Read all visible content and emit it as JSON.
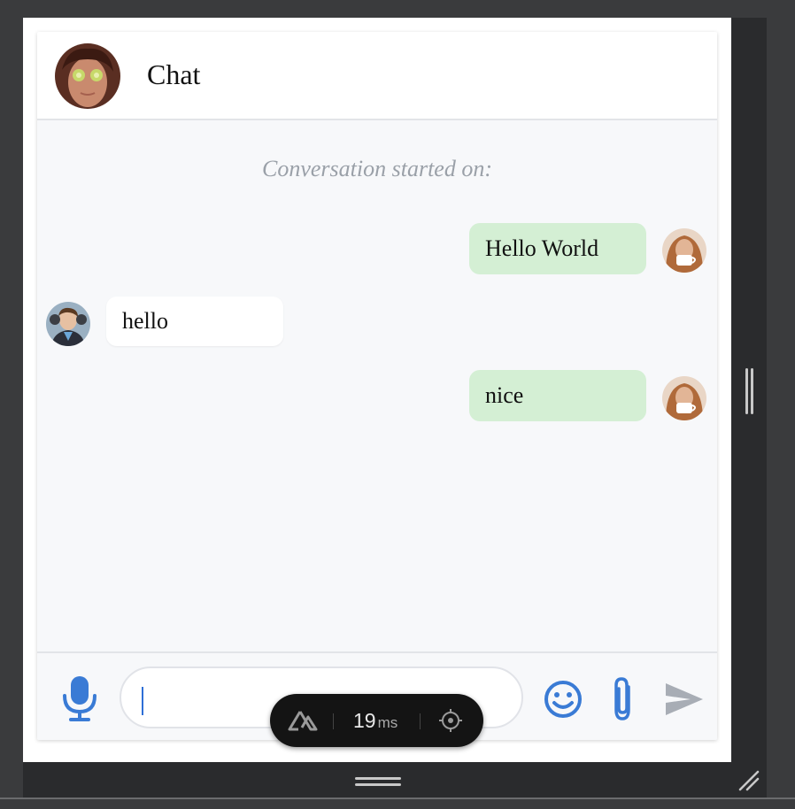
{
  "header": {
    "title": "Chat"
  },
  "conversation": {
    "started_label": "Conversation started on:",
    "messages": [
      {
        "direction": "out",
        "text": "Hello World"
      },
      {
        "direction": "in",
        "text": "hello"
      },
      {
        "direction": "out",
        "text": "nice"
      }
    ]
  },
  "composer": {
    "input_value": "",
    "input_placeholder": ""
  },
  "devtools": {
    "render_time": "19",
    "render_unit": "ms"
  },
  "colors": {
    "accent": "#3a7bd5",
    "outgoing_bubble": "#d4efd4",
    "incoming_bubble": "#ffffff",
    "send_icon": "#a8adb5"
  },
  "icons": [
    "microphone-icon",
    "emoji-icon",
    "paperclip-icon",
    "send-icon",
    "nuxt-logo-icon",
    "crosshair-icon"
  ]
}
